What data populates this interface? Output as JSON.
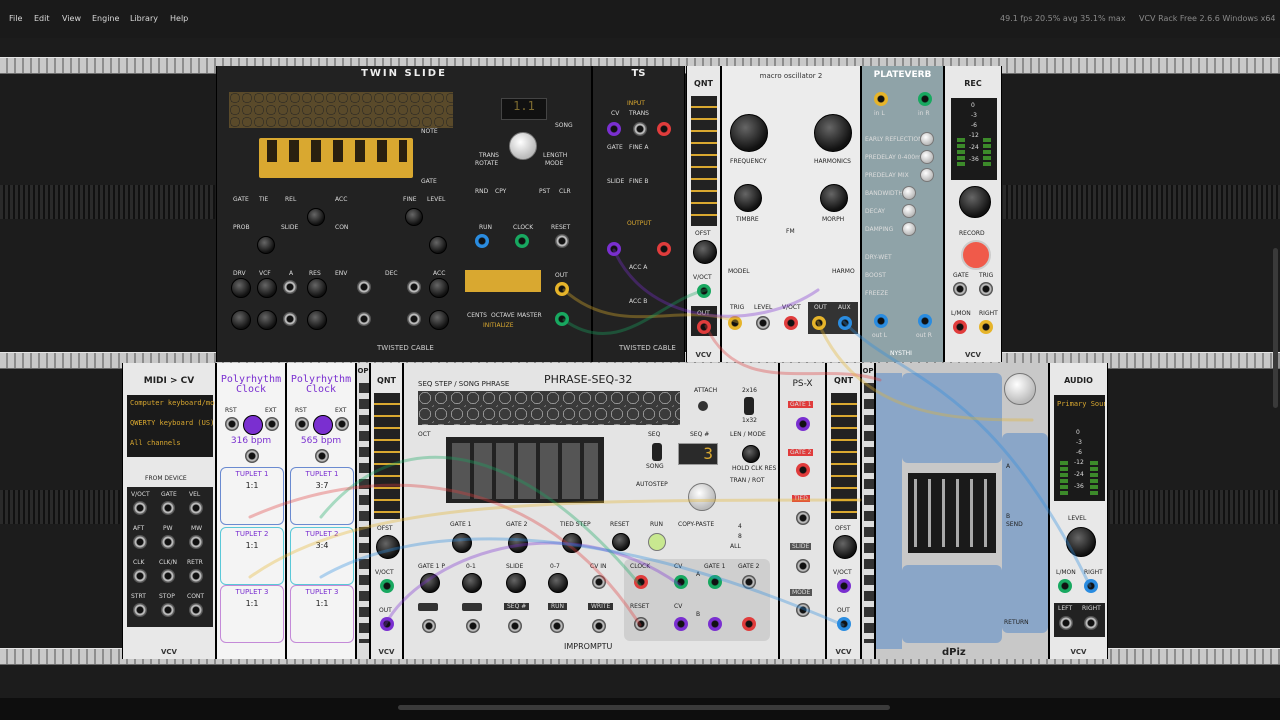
{
  "menu": [
    "File",
    "Edit",
    "View",
    "Engine",
    "Library",
    "Help"
  ],
  "status": {
    "fps": "49.1 fps  20.5% avg  35.1% max",
    "app": "VCV Rack Free 2.6.6 Windows x64"
  },
  "top_row": {
    "twinslide": {
      "title": "TWIN SLIDE",
      "labels": [
        "NOTE",
        "GATE",
        "TRANS",
        "ROTATE",
        "LENGTH",
        "MODE",
        "SONG",
        "SEQ",
        "RND",
        "CPY",
        "PST",
        "CLR",
        "RUN",
        "CLOCK",
        "RESET",
        "GATE",
        "TIE",
        "REL",
        "ACC",
        "PROB",
        "SLIDE",
        "CON",
        "FINE",
        "LEVEL",
        "DRV",
        "VCF",
        "A",
        "RES",
        "ENV",
        "DEC",
        "CENTS",
        "OCTAVE",
        "MASTER",
        "INITIALIZE",
        "OUT"
      ],
      "seq_display": "1.1",
      "brand": "TWISTED CABLE"
    },
    "ts": {
      "title": "TS",
      "labels": [
        "INPUT",
        "OUTPUT",
        "CV",
        "TRANS",
        "GATE",
        "FINE A",
        "SLIDE",
        "FINE B",
        "ACC A",
        "ACC B"
      ],
      "brand": "TWISTED CABLE"
    },
    "qnt": {
      "title": "QNT",
      "labels": [
        "OFST",
        "V/OCT",
        "OUT"
      ],
      "brand": "VCV"
    },
    "macro": {
      "title": "macro oscillator 2",
      "labels": [
        "FREQUENCY",
        "HARMONICS",
        "TIMBRE",
        "FM",
        "MORPH",
        "MODEL",
        "HARMO",
        "TRIG",
        "LEVEL",
        "V/OCT",
        "OUT",
        "AUX"
      ]
    },
    "plateverb": {
      "title": "PLATEVERB",
      "labels": [
        "EARLY REFLECTIONS",
        "PREDELAY 0-400ms",
        "PREDELAY MIX",
        "BANDWIDTH",
        "DECAY",
        "DAMPING",
        "DRY-WET",
        "BOOST",
        "FREEZE"
      ],
      "ports": [
        "in L",
        "in R",
        "out L",
        "out R"
      ],
      "brand": "NYSTHI"
    },
    "rec": {
      "title": "REC",
      "labels": [
        "RECORD",
        "GATE",
        "TRIG",
        "L/MON",
        "RIGHT"
      ],
      "meter": [
        "0",
        "-3",
        "-6",
        "-12",
        "-24",
        "-36"
      ],
      "brand": "VCV"
    }
  },
  "bottom_row": {
    "midicv": {
      "title": "MIDI > CV",
      "rows": [
        "Computer keyboard/mouse",
        "QWERTY keyboard (US)",
        "All channels"
      ],
      "section": "FROM DEVICE",
      "labels": [
        "V/OCT",
        "GATE",
        "VEL",
        "AFT",
        "PW",
        "MW",
        "CLK",
        "CLK/N",
        "RETR",
        "STRT",
        "STOP",
        "CONT"
      ],
      "brand": "VCV"
    },
    "poly1": {
      "title": "Polyrhythm Clock",
      "bpm": "316 bpm",
      "labels": [
        "RST",
        "EXT"
      ],
      "tuplets": [
        {
          "name": "TUPLET 1",
          "ratio": "1:1"
        },
        {
          "name": "TUPLET 2",
          "ratio": "1:1"
        },
        {
          "name": "TUPLET 3",
          "ratio": "1:1"
        }
      ]
    },
    "poly2": {
      "title": "Polyrhythm Clock",
      "bpm": "565 bpm",
      "labels": [
        "RST",
        "EXT"
      ],
      "tuplets": [
        {
          "name": "TUPLET 1",
          "ratio": "3:7"
        },
        {
          "name": "TUPLET 2",
          "ratio": "3:4"
        },
        {
          "name": "TUPLET 3",
          "ratio": "1:1"
        }
      ]
    },
    "op": {
      "title": "OP"
    },
    "qnt2": {
      "title": "QNT",
      "labels": [
        "OFST",
        "V/OCT",
        "OUT"
      ],
      "brand": "VCV"
    },
    "phraseseq": {
      "title": "PHRASE-SEQ-32",
      "subtitle": "SEQ STEP / SONG PHRASE",
      "seq_value": "3",
      "labels": [
        "ATTACH",
        "2x16",
        "1x32",
        "OCT",
        "SEQ",
        "SONG",
        "SEQ #",
        "LEN / MODE",
        "HOLD CLK RES",
        "AUTOSTEP",
        "TRAN / ROT",
        "GATE 1",
        "GATE 2",
        "TIED STEP",
        "RESET",
        "RUN",
        "COPY-PASTE",
        "4",
        "8",
        "ALL",
        "GATE 1 P",
        "0-1",
        "SLIDE",
        "0-7",
        "CV IN",
        "CLOCK",
        "RESET",
        "CV",
        "A",
        "B",
        "SEQ #",
        "RUN",
        "WRITE"
      ],
      "brand": "IMPROMPTU"
    },
    "psx": {
      "title": "PS-X",
      "labels": [
        "GATE 1",
        "GATE 2",
        "TIED",
        "SLIDE",
        "MODE"
      ]
    },
    "qnt3": {
      "title": "QNT",
      "labels": [
        "OFST",
        "V/OCT",
        "OUT"
      ],
      "brand": "VCV"
    },
    "op2": {
      "title": "OP"
    },
    "dpiz": {
      "brand": "dPiz",
      "labels": [
        "A",
        "B",
        "SEND",
        "RETURN"
      ]
    },
    "audio": {
      "title": "AUDIO",
      "device": "Primary Sound Driver",
      "meter": [
        "0",
        "-3",
        "-6",
        "-12",
        "-24",
        "-36"
      ],
      "labels": [
        "LEVEL",
        "L/MON",
        "RIGHT",
        "LEFT",
        "RIGHT"
      ],
      "brand": "VCV"
    }
  },
  "colors": {
    "rail": "#c9c9c9",
    "rack": "#1c1c1c",
    "accent_gold": "#e6b42a",
    "accent_purple": "#7a2fd0",
    "accent_green": "#18a860",
    "accent_red": "#e03c3c",
    "accent_blue": "#2a8ce0"
  }
}
